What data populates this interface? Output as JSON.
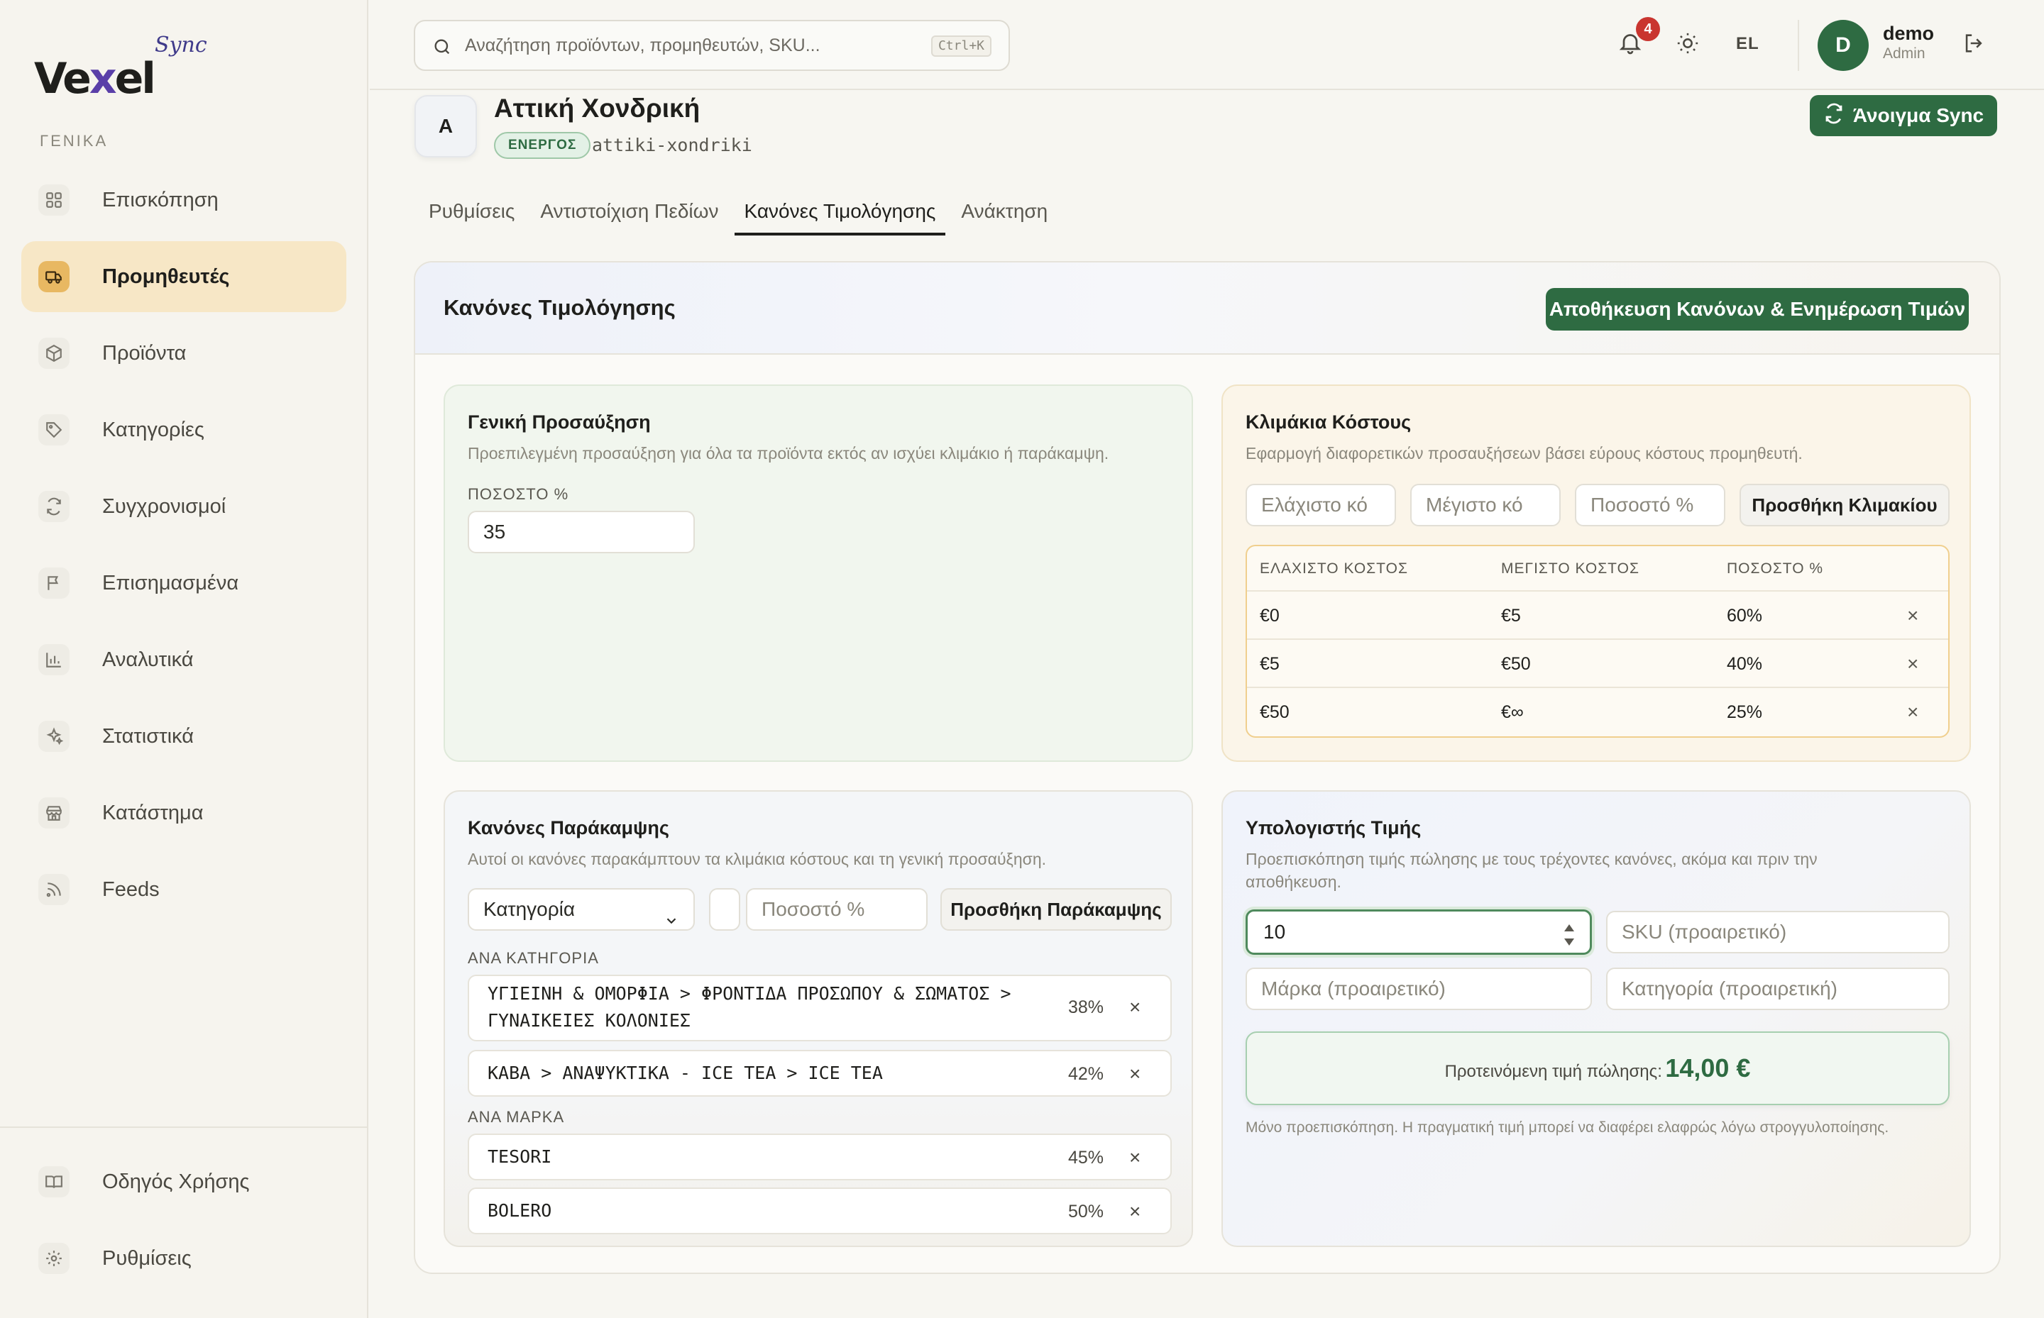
{
  "app": {
    "logo_main": "Vexel",
    "logo_sync": "Sync"
  },
  "sidebar": {
    "section_label": "ΓΕΝΙΚΑ",
    "items": [
      {
        "label": "Επισκόπηση",
        "icon": "grid-icon",
        "active": false
      },
      {
        "label": "Προμηθευτές",
        "icon": "truck-icon",
        "active": true
      },
      {
        "label": "Προϊόντα",
        "icon": "box-icon",
        "active": false
      },
      {
        "label": "Κατηγορίες",
        "icon": "tag-icon",
        "active": false
      },
      {
        "label": "Συγχρονισμοί",
        "icon": "refresh-icon",
        "active": false
      },
      {
        "label": "Επισημασμένα",
        "icon": "flag-icon",
        "active": false
      },
      {
        "label": "Αναλυτικά",
        "icon": "bar-chart-icon",
        "active": false
      },
      {
        "label": "Στατιστικά",
        "icon": "sparkles-icon",
        "active": false
      },
      {
        "label": "Κατάστημα",
        "icon": "store-icon",
        "active": false
      },
      {
        "label": "Feeds",
        "icon": "rss-icon",
        "active": false
      }
    ],
    "bottom_items": [
      {
        "label": "Οδηγός Χρήσης",
        "icon": "book-icon"
      },
      {
        "label": "Ρυθμίσεις",
        "icon": "settings-icon"
      }
    ]
  },
  "topbar": {
    "search_placeholder": "Αναζήτηση προϊόντων, προμηθευτών, SKU...",
    "search_shortcut": "Ctrl+K",
    "notifications_count": "4",
    "language": "EL",
    "user_initial": "D",
    "user_name": "demo",
    "user_role": "Admin"
  },
  "supplier": {
    "initial": "A",
    "name": "Αττική Χονδρική",
    "status": "ΕΝΕΡΓΟΣ",
    "slug": "attiki-xondriki",
    "sync_button": "Άνοιγμα Sync"
  },
  "tabs": [
    {
      "label": "Ρυθμίσεις",
      "active": false
    },
    {
      "label": "Αντιστοίχιση Πεδίων",
      "active": false
    },
    {
      "label": "Κανόνες Τιμολόγησης",
      "active": true
    },
    {
      "label": "Ανάκτηση",
      "active": false
    }
  ],
  "pricing": {
    "title": "Κανόνες Τιμολόγησης",
    "save_button": "Αποθήκευση Κανόνων & Ενημέρωση Τιμών",
    "general": {
      "title": "Γενική Προσαύξηση",
      "description": "Προεπιλεγμένη προσαύξηση για όλα τα προϊόντα εκτός αν ισχύει κλιμάκιο ή παράκαμψη.",
      "field_label": "ΠΟΣΟΣΤΟ %",
      "value": "35"
    },
    "tiers": {
      "title": "Κλιμάκια Κόστους",
      "description": "Εφαρμογή διαφορετικών προσαυξήσεων βάσει εύρους κόστους προμηθευτή.",
      "min_placeholder": "Ελάχιστο κό",
      "max_placeholder": "Μέγιστο κό",
      "pct_placeholder": "Ποσοστό %",
      "add_button": "Προσθήκη Κλιμακίου",
      "headers": {
        "min": "ΕΛΑΧΙΣΤΟ ΚΟΣΤΟΣ",
        "max": "ΜΕΓΙΣΤΟ ΚΟΣΤΟΣ",
        "pct": "ΠΟΣΟΣΤΟ %"
      },
      "rows": [
        {
          "min": "€0",
          "max": "€5",
          "pct": "60%"
        },
        {
          "min": "€5",
          "max": "€50",
          "pct": "40%"
        },
        {
          "min": "€50",
          "max": "€∞",
          "pct": "25%"
        }
      ],
      "remove_symbol": "×"
    },
    "overrides": {
      "title": "Κανόνες Παράκαμψης",
      "description": "Αυτοί οι κανόνες παρακάμπτουν τα κλιμάκια κόστους και τη γενική προσαύξηση.",
      "type_select": "Κατηγορία",
      "pct_placeholder": "Ποσοστό %",
      "add_button": "Προσθήκη Παράκαμψης",
      "by_category_label": "ΑΝΑ ΚΑΤΗΓΟΡΙΑ",
      "by_category": [
        {
          "line1": "ΥΓΙΕΙΝΗ & ΟΜΟΡΦΙΑ > ΦΡΟΝΤΙΔΑ ΠΡΟΣΩΠΟΥ & ΣΩΜΑΤΟΣ >",
          "line2": "ΓΥΝΑΙΚΕΙΕΣ ΚΟΛΟΝΙΕΣ",
          "pct": "38%"
        },
        {
          "line1": "ΚΑΒΑ > ΑΝΑΨΥΚΤΙΚΑ - ICE TEA > ICE TEA",
          "line2": "",
          "pct": "42%"
        }
      ],
      "by_brand_label": "ΑΝΑ ΜΑΡΚΑ",
      "by_brand": [
        {
          "name": "TESORI",
          "pct": "45%"
        },
        {
          "name": "BOLERO",
          "pct": "50%"
        }
      ],
      "remove_symbol": "×"
    },
    "calculator": {
      "title": "Υπολογιστής Τιμής",
      "description_line1": "Προεπισκόπηση τιμής πώλησης με τους τρέχοντες κανόνες, ακόμα και πριν την",
      "description_line2": "αποθήκευση.",
      "cost_value": "10",
      "sku_placeholder": "SKU (προαιρετικό)",
      "brand_placeholder": "Μάρκα (προαιρετικό)",
      "category_placeholder": "Κατηγορία (προαιρετική)",
      "result_label": "Προτεινόμενη τιμή πώλησης:",
      "result_value": "14,00 €",
      "note": "Μόνο προεπισκόπηση. Η πραγματική τιμή μπορεί να διαφέρει ελαφρώς λόγω στρογγυλοποίησης."
    }
  },
  "colors": {
    "accent": "#2e6b42",
    "active_nav": "#f7e7c6",
    "badge": "#c9352f",
    "tier_border": "#f0cf8e"
  }
}
